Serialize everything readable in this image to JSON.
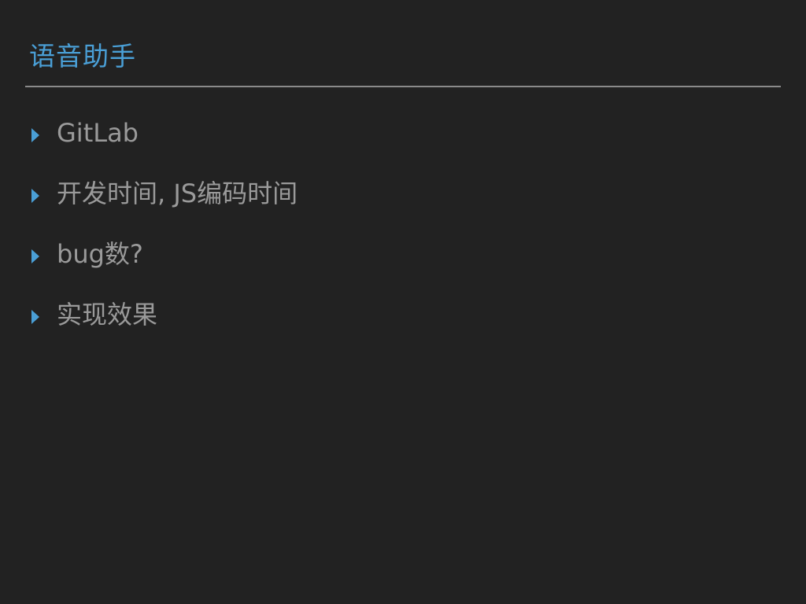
{
  "slide": {
    "title": "语音助手",
    "bullets": [
      {
        "text": "GitLab",
        "icon": "triangle-right-icon"
      },
      {
        "text": "开发时间, JS编码时间",
        "icon": "triangle-right-icon"
      },
      {
        "text": "bug数?",
        "icon": "triangle-right-icon"
      },
      {
        "text": "实现效果",
        "icon": "triangle-right-icon"
      }
    ]
  },
  "colors": {
    "background": "#222222",
    "accent": "#4a9fd6",
    "text": "#9a9a9a",
    "divider": "#8a8a8a"
  }
}
